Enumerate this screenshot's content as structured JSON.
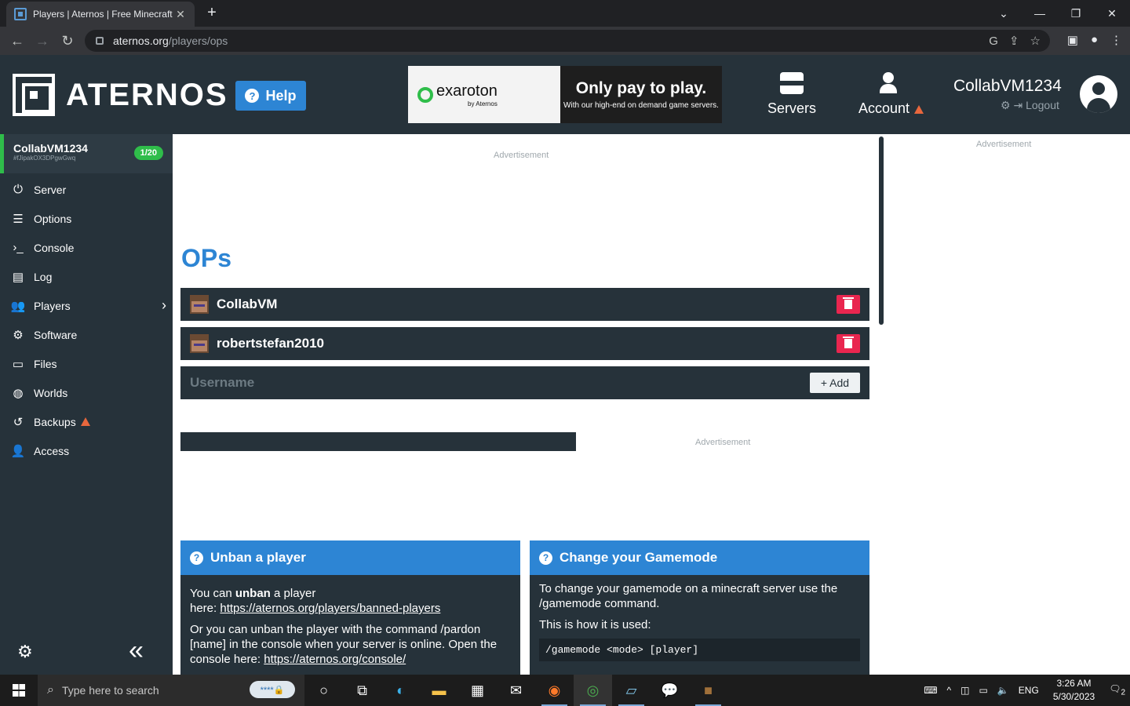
{
  "browser": {
    "tab_title": "Players | Aternos | Free Minecraft",
    "url_host": "aternos.org",
    "url_path": "/players/ops"
  },
  "header": {
    "logo_text": "ATERNOS",
    "help_label": "Help",
    "banner": {
      "brand": "exaroton",
      "brand_sub": "by Aternos",
      "headline": "Only pay to play.",
      "tagline": "With our high-end on demand game servers."
    },
    "nav": {
      "servers_label": "Servers",
      "account_label": "Account"
    },
    "user": {
      "name": "CollabVM1234",
      "logout_label": "Logout"
    }
  },
  "sidebar": {
    "server_name": "CollabVM1234",
    "server_id": "#fJipakOX3DPgwGwq",
    "player_badge": "1/20",
    "items": [
      {
        "label": "Server",
        "icon": "power-icon"
      },
      {
        "label": "Options",
        "icon": "sliders-icon"
      },
      {
        "label": "Console",
        "icon": "terminal-icon"
      },
      {
        "label": "Log",
        "icon": "file-icon"
      },
      {
        "label": "Players",
        "icon": "users-icon"
      },
      {
        "label": "Software",
        "icon": "gears-icon"
      },
      {
        "label": "Files",
        "icon": "folder-icon"
      },
      {
        "label": "Worlds",
        "icon": "globe-icon"
      },
      {
        "label": "Backups",
        "icon": "history-icon"
      },
      {
        "label": "Access",
        "icon": "user-lock-icon"
      }
    ]
  },
  "main": {
    "ad_label": "Advertisement",
    "title": "OPs",
    "ops": [
      {
        "name": "CollabVM"
      },
      {
        "name": "robertstefan2010"
      }
    ],
    "input_placeholder": "Username",
    "add_label": "+ Add",
    "cards": {
      "unban": {
        "title": "Unban a player",
        "line1_pre": "You can ",
        "line1_bold": "unban",
        "line1_post": " a player",
        "line2_pre": "here: ",
        "link1": "https://aternos.org/players/banned-players",
        "para2": "Or you can unban the player with the command /pardon [name] in the console when your server is online. Open the console here: ",
        "link2": "https://aternos.org/console/"
      },
      "gamemode": {
        "title": "Change your Gamemode",
        "para1": "To change your gamemode on a minecraft server use the /gamemode command.",
        "para2": "This is how it is used:",
        "code": "/gamemode <mode> [player]"
      }
    }
  },
  "right_column": {
    "ad_label": "Advertisement"
  },
  "taskbar": {
    "search_placeholder": "Type here to search",
    "language": "ENG",
    "time": "3:26 AM",
    "date": "5/30/2023",
    "notification_count": "2"
  },
  "colors": {
    "brand_blue": "#2d85d4",
    "dark_panel": "#26323a",
    "online_green": "#2fbd4a",
    "delete_red": "#e9264f"
  }
}
